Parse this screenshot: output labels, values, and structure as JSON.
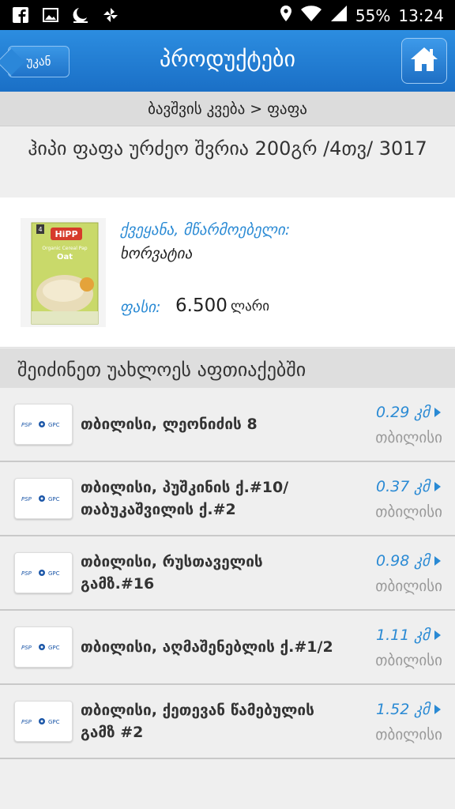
{
  "status_bar": {
    "battery": "55%",
    "time": "13:24"
  },
  "header": {
    "back_label": "უკან",
    "title": "პროდუქტები"
  },
  "breadcrumb": "ბავშვის კვება > ფაფა",
  "product": {
    "title": "ჰიპი ფაფა ურძეო შვრია 200გრ /4თვ/ 3017",
    "country_label": "ქვეყანა, მწარმოებელი:",
    "country_value": "ხორვატია",
    "price_label": "ფასი:",
    "price_value": "6.500",
    "price_currency": "ლარი"
  },
  "section_title": "შეიძინეთ უახლოეს აფთიაქებში",
  "pharmacies": [
    {
      "address": "თბილისი, ლეონიძის 8",
      "distance": "0.29 კმ",
      "city": "თბილისი"
    },
    {
      "address": "თბილისი, პუშკინის ქ.#10/ თაბუკაშვილის ქ.#2",
      "distance": "0.37 კმ",
      "city": "თბილისი"
    },
    {
      "address": "თბილისი, რუსთაველის გამზ.#16",
      "distance": "0.98 კმ",
      "city": "თბილისი"
    },
    {
      "address": "თბილისი, აღმაშენებლის ქ.#1/2",
      "distance": "1.11 კმ",
      "city": "თბილისი"
    },
    {
      "address": "თბილისი, ქეთევან წამებულის გამზ #2",
      "distance": "1.52 კმ",
      "city": "თბილისი"
    }
  ],
  "colors": {
    "accent": "#2a8ad4",
    "header_bg": "#1a6fc6"
  }
}
